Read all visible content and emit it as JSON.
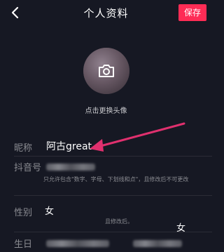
{
  "header": {
    "title": "个人资料",
    "save_label": "保存"
  },
  "avatar": {
    "hint": "点击更换头像"
  },
  "fields": {
    "nickname": {
      "label": "昵称",
      "value": "阿古great"
    },
    "douyin_id": {
      "label": "抖音号",
      "hint": "只允许包含\"数字、字母、下划线和点\"，且修改后不可更改"
    },
    "gender": {
      "label": "性别",
      "value": "女",
      "hint": "且修改后。"
    },
    "birthday": {
      "label": "生日",
      "value": "女"
    }
  },
  "colors": {
    "background": "#161823",
    "accent": "#fe2c55",
    "label": "#8a8b91"
  }
}
